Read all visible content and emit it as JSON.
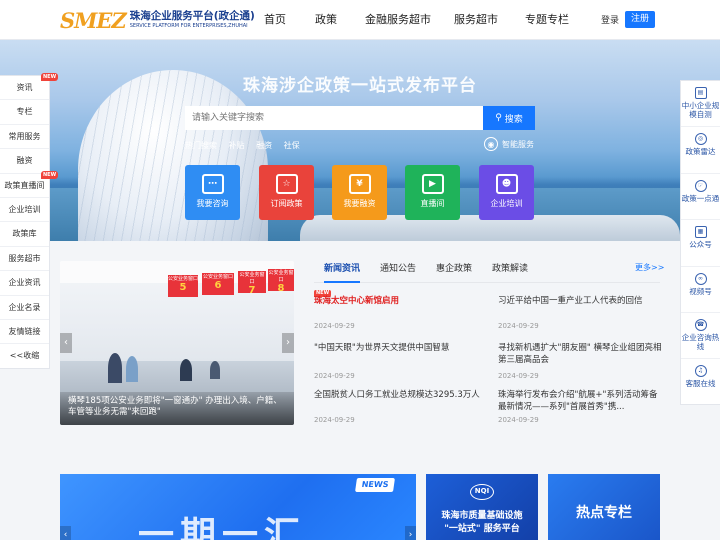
{
  "header": {
    "logo_mark": "SMEZ",
    "logo_cn": "珠海企业服务平台(政企通)",
    "logo_en": "SERVICE PLATFORM FOR ENTERPRISES,ZHUHAI",
    "nav": [
      "首页",
      "政策",
      "金融服务超市",
      "服务超市",
      "专题专栏"
    ],
    "login": "登录",
    "register": "注册"
  },
  "hero": {
    "title": "珠海涉企政策一站式发布平台",
    "search_placeholder": "请输入关键字搜索",
    "search_button": "搜索",
    "hot_label": "热门搜索",
    "hot_terms": [
      "补贴",
      "融资",
      "社保"
    ],
    "smart_service": "智能服务",
    "tiles": [
      {
        "label": "我要咨询",
        "color": "#2f8df3",
        "icon": "chat-icon"
      },
      {
        "label": "订阅政策",
        "color": "#e9433b",
        "icon": "star-doc-icon"
      },
      {
        "label": "我要融资",
        "color": "#f59a1b",
        "icon": "yuan-icon"
      },
      {
        "label": "直播间",
        "color": "#1fb35a",
        "icon": "video-icon"
      },
      {
        "label": "企业培训",
        "color": "#6b4de6",
        "icon": "training-icon"
      }
    ]
  },
  "left_sidebar": {
    "items": [
      {
        "label": "资讯",
        "new": true
      },
      {
        "label": "专栏",
        "new": false
      },
      {
        "label": "常用服务",
        "new": false
      },
      {
        "label": "融资",
        "new": false
      },
      {
        "label": "政策直播间",
        "new": true
      },
      {
        "label": "企业培训",
        "new": false
      },
      {
        "label": "政策库",
        "new": false
      },
      {
        "label": "服务超市",
        "new": false
      },
      {
        "label": "企业资讯",
        "new": false
      },
      {
        "label": "企业名录",
        "new": false
      },
      {
        "label": "友情链接",
        "new": false
      },
      {
        "label": "<<收缩",
        "new": false
      }
    ],
    "new_tag": "NEW"
  },
  "right_sidebar": {
    "items": [
      {
        "label": "中小企业规模自测",
        "icon": "chart-icon"
      },
      {
        "label": "政策雷达",
        "icon": "radar-icon"
      },
      {
        "label": "政策一点通",
        "icon": "pointer-icon"
      },
      {
        "label": "公众号",
        "icon": "qrcode-icon"
      },
      {
        "label": "视频号",
        "icon": "video-channel-icon"
      },
      {
        "label": "企业咨询热线",
        "icon": "phone-icon"
      },
      {
        "label": "客服在线",
        "icon": "headset-icon"
      }
    ]
  },
  "news": {
    "photo_caption": "横琴185项公安业务即将\"一窗通办\" 办理出入境、户籍、车管等业务无需\"来回跑\"",
    "photo_signs": [
      {
        "num": "5",
        "text": "公安业务窗口"
      },
      {
        "num": "6",
        "text": "公安业务窗口"
      },
      {
        "num": "7",
        "text": "公安业务窗口"
      },
      {
        "num": "8",
        "text": "公安业务窗口"
      }
    ],
    "tabs": [
      "新闻资讯",
      "通知公告",
      "惠企政策",
      "政策解读"
    ],
    "more": "更多>>",
    "new_badge": "NEW",
    "items": [
      {
        "title": "珠海太空中心新馆启用",
        "date": "2024-09-29",
        "highlight": true
      },
      {
        "title": "习近平给中国一重产业工人代表的回信",
        "date": "2024-09-29",
        "highlight": false
      },
      {
        "title": "\"中国天眼\"为世界天文提供中国智慧",
        "date": "2024-09-29",
        "highlight": false
      },
      {
        "title": "寻找新机遇扩大\"朋友圈\" 横琴企业组团亮相第三届高品会",
        "date": "2024-09-29",
        "highlight": false
      },
      {
        "title": "全国脱贫人口务工就业总规模达3295.3万人",
        "date": "2024-09-29",
        "highlight": false
      },
      {
        "title": "珠海举行发布会介绍\"航展+\"系列活动筹备最新情况——系列\"首展首秀\"携...",
        "date": "2024-09-29",
        "highlight": false
      }
    ]
  },
  "banners": {
    "b1_text": "一期一汇",
    "b1_tag": "NEWS",
    "b2_logo": "NQI",
    "b2_lines": [
      "珠海市质量基础设施",
      "\"一站式\" 服务平台"
    ],
    "b3_text": "热点专栏"
  }
}
